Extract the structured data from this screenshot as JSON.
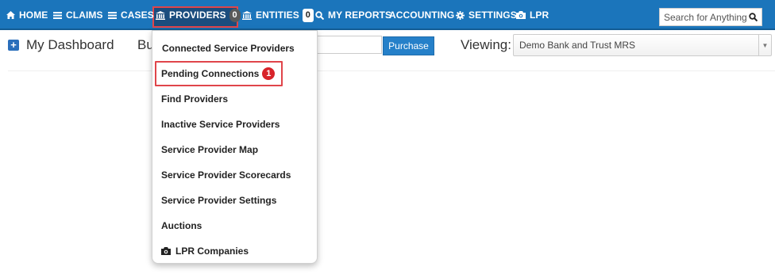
{
  "navbar": {
    "home": "HOME",
    "claims": "CLAIMS",
    "cases": "CASES",
    "providers": "PROVIDERS",
    "providers_count": "0",
    "entities": "ENTITIES",
    "entities_count": "0",
    "my_reports": "MY REPORTS",
    "accounting": "ACCOUNTING",
    "settings": "SETTINGS",
    "lpr": "LPR",
    "search_placeholder": "Search for Anything",
    "colors": {
      "bar": "#1b75bb",
      "highlight": "#e0454a"
    }
  },
  "dashboard": {
    "title": "My Dashboard",
    "bu_label": "Bu",
    "purchase_label": "Purchase",
    "viewing_label": "Viewing:",
    "viewing_value": "Demo Bank and Trust MRS"
  },
  "providers_menu": {
    "items": [
      {
        "label": "Connected Service Providers"
      },
      {
        "label": "Pending Connections",
        "badge": "1"
      },
      {
        "label": "Find Providers"
      },
      {
        "label": "Inactive Service Providers"
      },
      {
        "label": "Service Provider Map"
      },
      {
        "label": "Service Provider Scorecards"
      },
      {
        "label": "Service Provider Settings"
      },
      {
        "label": "Auctions"
      },
      {
        "label": "LPR Companies",
        "icon": "camera-icon"
      }
    ]
  }
}
